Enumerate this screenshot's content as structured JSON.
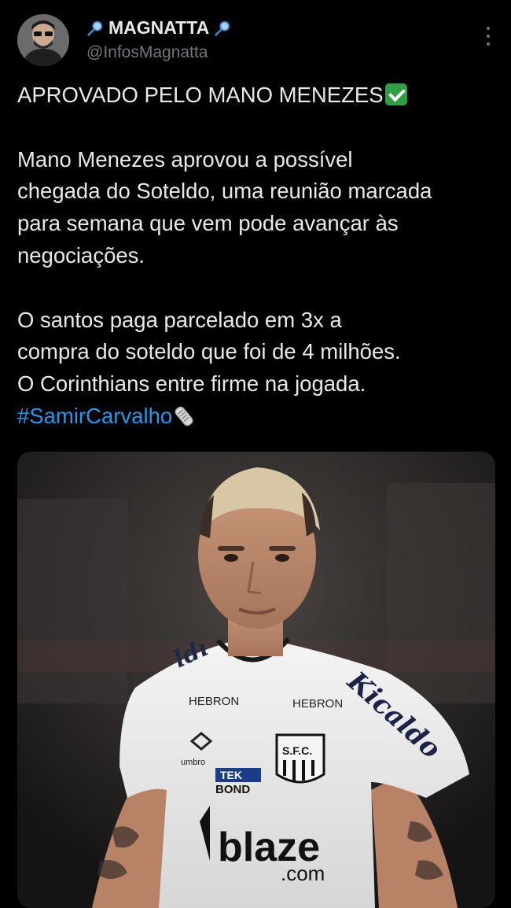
{
  "tweet": {
    "author": {
      "display_name": "MAGNATTA",
      "handle": "@InfosMagnatta"
    },
    "paragraphs": [
      "APROVADO PELO MANO MENEZES",
      "Mano Menezes aprovou a possível",
      "chegada do Soteldo, uma reunião marcada",
      "para semana que vem pode avançar às",
      "negociações.",
      "O santos paga parcelado em 3x a",
      "compra do soteldo que foi de 4 milhões.",
      "O Corinthians entre firme na jogada."
    ],
    "hashtag": "#SamirCarvalho",
    "media": {
      "jersey_texts": {
        "sponsor_hebron_1": "HEBRON",
        "sponsor_hebron_2": "HEBRON",
        "sleeve_brand": "Kicaldo",
        "chest_tek": "TEK",
        "chest_bond": "BOND",
        "kit_brand": "umbro",
        "main_sponsor": "blaze",
        "main_sponsor_sub": ".com",
        "crest": "S.F.C."
      }
    }
  },
  "icons": {
    "pin_left": "magnifier-pin-icon",
    "pin_right": "magnifier-pin-icon",
    "check": "check-mark-emoji",
    "newspaper": "rolled-newspaper-emoji",
    "more": "more-options-icon"
  },
  "colors": {
    "background": "#000000",
    "text": "#e7e9ea",
    "secondary": "#71767b",
    "link": "#1d9bf0",
    "check": "#2ea043"
  }
}
